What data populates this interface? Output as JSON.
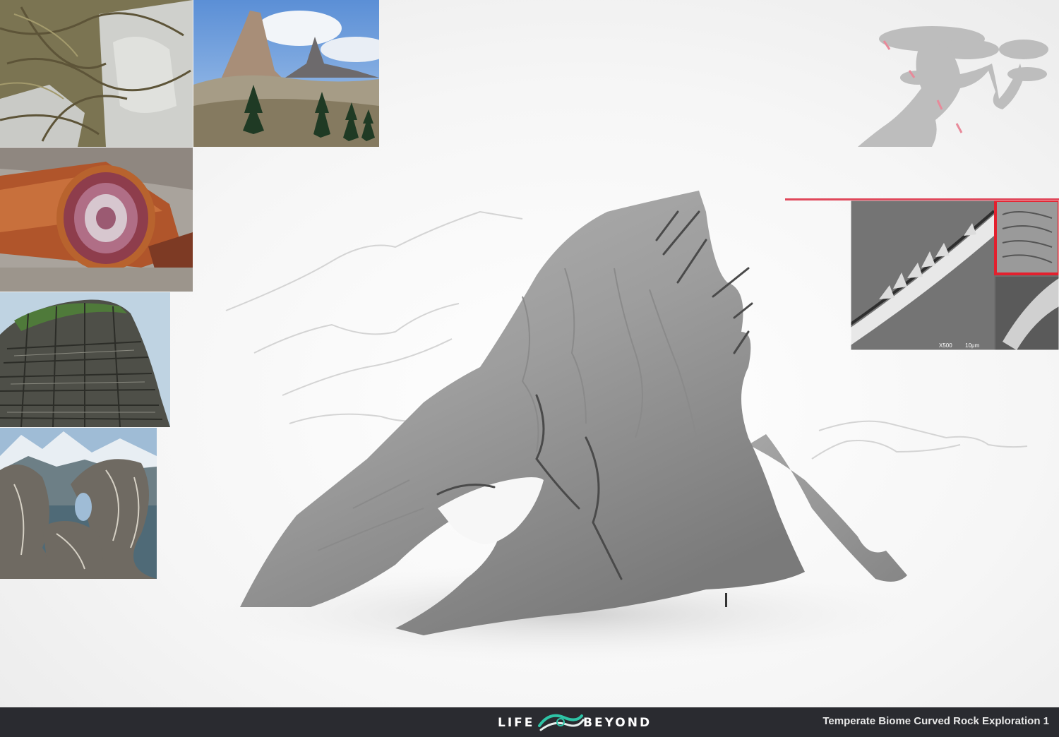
{
  "footer": {
    "logo_left": "LIFE",
    "logo_right": "BEYOND",
    "title": "Temperate Biome Curved Rock Exploration 1"
  },
  "references": {
    "micro_magnification": "X500",
    "micro_scale": "10μm"
  },
  "icons": [
    "logo-swirl-icon"
  ],
  "colors": {
    "footer_bg": "#2a2b30",
    "accent_red": "#e0475a",
    "logo_teal": "#2ec4a6",
    "rock_gray": "#8e8e8e"
  }
}
